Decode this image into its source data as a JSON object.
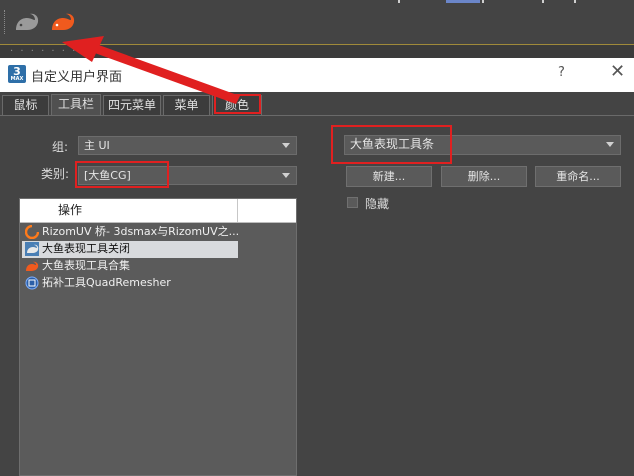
{
  "toolbar": {
    "buttons": [
      {
        "name": "gray-whale-icon",
        "color": "#9a9a9a"
      },
      {
        "name": "orange-whale-icon",
        "color": "#f05a1e"
      }
    ]
  },
  "dialog": {
    "title": "自定义用户界面",
    "help": "?",
    "close": "✕",
    "tabs": [
      "鼠标",
      "工具栏",
      "四元菜单",
      "菜单",
      "颜色"
    ],
    "active_tab": "工具栏",
    "left": {
      "group_label": "组:",
      "group_value": "主 UI",
      "category_label": "类别:",
      "category_value": "[大鱼CG]",
      "list_header": "操作",
      "actions": [
        {
          "label": "RizomUV 桥- 3dsmax与RizomUV之...",
          "icon": "rizomuv-icon"
        },
        {
          "label": "大鱼表现工具关闭",
          "icon": "whale-blue-icon",
          "selected": true
        },
        {
          "label": "大鱼表现工具合集",
          "icon": "whale-orange-icon"
        },
        {
          "label": "拓补工具QuadRemesher",
          "icon": "quadremesher-icon"
        }
      ]
    },
    "right": {
      "toolbar_value": "大鱼表现工具条",
      "new_label": "新建...",
      "delete_label": "删除...",
      "rename_label": "重命名...",
      "hide_label": "隐藏"
    }
  },
  "colors": {
    "annotation_red": "#e02020",
    "panel_bg": "#444444"
  }
}
